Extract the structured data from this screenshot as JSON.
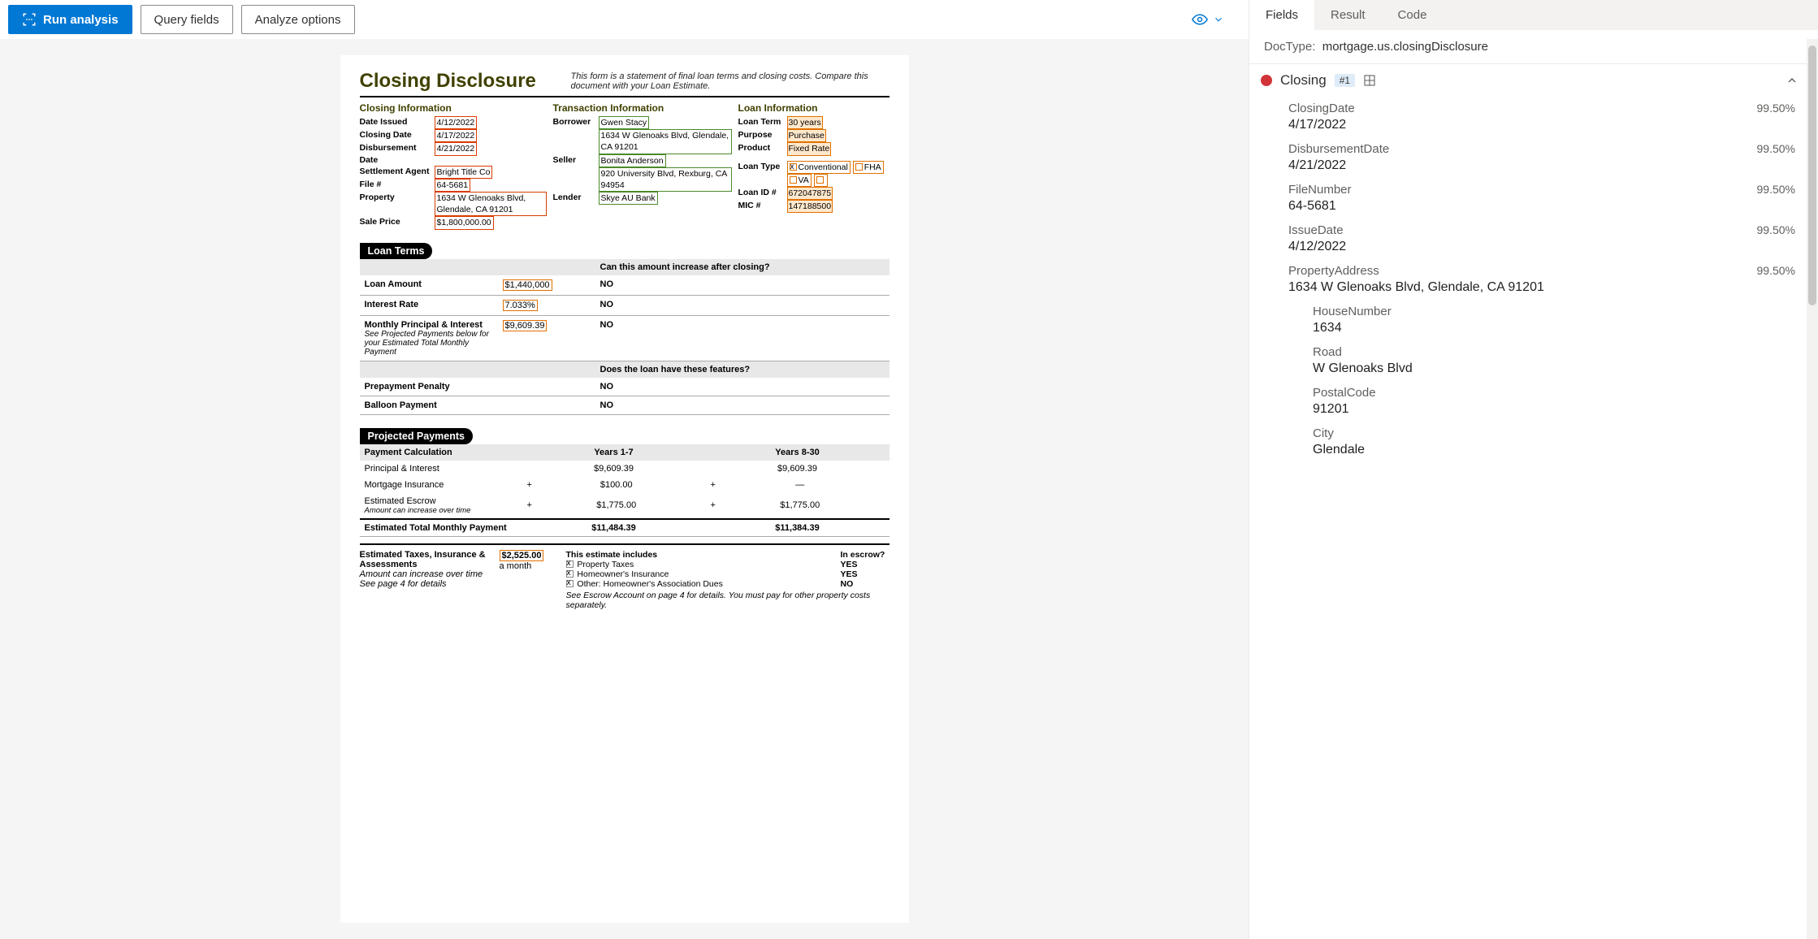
{
  "toolbar": {
    "run": "Run analysis",
    "query": "Query fields",
    "analyze": "Analyze options"
  },
  "doc": {
    "title": "Closing Disclosure",
    "note": "This form is a statement of final loan terms and closing costs. Compare this document with your Loan Estimate.",
    "closing_info_head": "Closing  Information",
    "transaction_info_head": "Transaction  Information",
    "loan_info_head": "Loan  Information",
    "ci": {
      "date_issued_k": "Date Issued",
      "date_issued_v": "4/12/2022",
      "closing_date_k": "Closing Date",
      "closing_date_v": "4/17/2022",
      "disb_date_k": "Disbursement Date",
      "disb_date_v": "4/21/2022",
      "settle_k": "Settlement Agent",
      "settle_v": "Bright Title Co",
      "file_k": "File #",
      "file_v": "64-5681",
      "property_k": "Property",
      "property_v": "1634 W Glenoaks Blvd, Glendale, CA 91201",
      "sale_k": "Sale Price",
      "sale_v": "$1,800,000.00"
    },
    "ti": {
      "borrower_k": "Borrower",
      "borrower_name": "Gwen Stacy",
      "borrower_addr": "1634 W Glenoaks Blvd, Glendale, CA 91201",
      "seller_k": "Seller",
      "seller_name": "Bonita Anderson",
      "seller_addr": "920 University Blvd, Rexburg, CA 94954",
      "lender_k": "Lender",
      "lender_v": "Skye AU Bank"
    },
    "li": {
      "term_k": "Loan Term",
      "term_v": "30 years",
      "purpose_k": "Purpose",
      "purpose_v": "Purchase",
      "product_k": "Product",
      "product_v": "Fixed Rate",
      "type_k": "Loan Type",
      "type_conv": "Conventional",
      "type_fha": "FHA",
      "type_va": "VA",
      "id_k": "Loan ID #",
      "id_v": "672047875",
      "mic_k": "MIC #",
      "mic_v": "147188500"
    },
    "loan_terms_bar": "Loan Terms",
    "lt_q1": "Can this amount increase after closing?",
    "lt_rows": [
      {
        "label": "Loan Amount",
        "val": "$1,440,000",
        "ans": "NO"
      },
      {
        "label": "Interest Rate",
        "val": "7.033%",
        "ans": "NO"
      },
      {
        "label": "Monthly Principal & Interest",
        "sub": "See Projected Payments below for your Estimated Total Monthly Payment",
        "val": "$9,609.39",
        "ans": "NO"
      }
    ],
    "lt_q2": "Does the loan have these features?",
    "lt_rows2": [
      {
        "label": "Prepayment Penalty",
        "ans": "NO"
      },
      {
        "label": "Balloon Payment",
        "ans": "NO"
      }
    ],
    "pp_bar": "Projected Payments",
    "pp_head": [
      "Payment Calculation",
      "Years 1-7",
      "Years 8-30"
    ],
    "pp_rows": [
      {
        "l": "Principal & Interest",
        "a": "$9,609.39",
        "b": "$9,609.39",
        "plus": false
      },
      {
        "l": "Mortgage Insurance",
        "a": "$100.00",
        "b": "—",
        "plus": true
      },
      {
        "l": "Estimated Escrow",
        "sub": "Amount can increase over time",
        "a": "$1,775.00",
        "b": "$1,775.00",
        "plus": true
      }
    ],
    "pp_total": {
      "l": "Estimated Total Monthly Payment",
      "a": "$11,484.39",
      "b": "$11,384.39"
    },
    "est": {
      "left_bold": "Estimated Taxes, Insurance & Assessments",
      "left_sub1": "Amount can increase over time",
      "left_sub2": "See page 4 for details",
      "amt": "$2,525.00",
      "per": "a month",
      "includes": "This estimate includes",
      "escrow_hdr": "In escrow?",
      "rows": [
        {
          "t": "Property Taxes",
          "e": "YES"
        },
        {
          "t": "Homeowner's Insurance",
          "e": "YES"
        },
        {
          "t": "Other: Homeowner's Association Dues",
          "e": "NO"
        }
      ],
      "foot": "See Escrow Account on page 4 for details. You must pay for other property costs separately."
    }
  },
  "right": {
    "tabs": [
      "Fields",
      "Result",
      "Code"
    ],
    "doctype_label": "DocType:",
    "doctype_value": "mortgage.us.closingDisclosure",
    "group_name": "Closing",
    "group_badge": "#1",
    "fields": [
      {
        "name": "ClosingDate",
        "value": "4/17/2022",
        "conf": "99.50%"
      },
      {
        "name": "DisbursementDate",
        "value": "4/21/2022",
        "conf": "99.50%"
      },
      {
        "name": "FileNumber",
        "value": "64-5681",
        "conf": "99.50%"
      },
      {
        "name": "IssueDate",
        "value": "4/12/2022",
        "conf": "99.50%"
      },
      {
        "name": "PropertyAddress",
        "value": "1634 W Glenoaks Blvd, Glendale, CA 91201",
        "conf": "99.50%"
      }
    ],
    "subfields": [
      {
        "name": "HouseNumber",
        "value": "1634"
      },
      {
        "name": "Road",
        "value": "W Glenoaks Blvd"
      },
      {
        "name": "PostalCode",
        "value": "91201"
      },
      {
        "name": "City",
        "value": "Glendale"
      }
    ]
  }
}
